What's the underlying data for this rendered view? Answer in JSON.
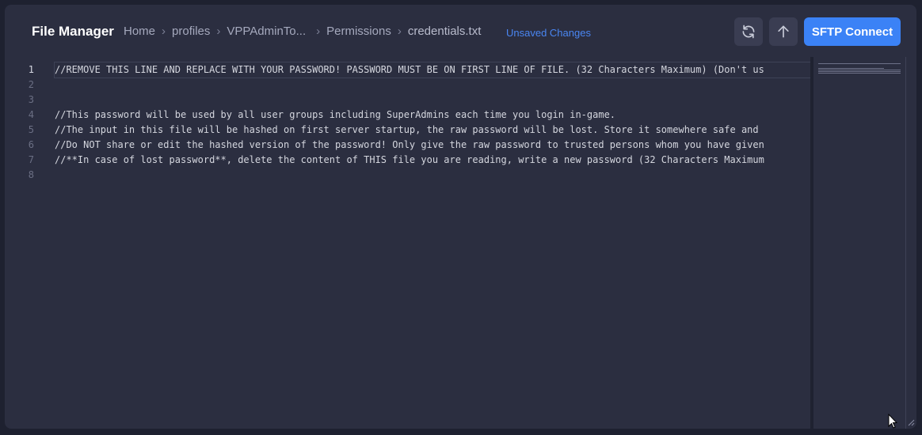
{
  "header": {
    "title": "File Manager",
    "breadcrumb": [
      "Home",
      "profiles",
      "VPPAdminTo...",
      "Permissions",
      "credentials.txt"
    ],
    "unsaved": "Unsaved Changes",
    "refresh_icon": "refresh-icon",
    "upload_icon": "arrow-up-icon",
    "sftp_label": "SFTP Connect"
  },
  "editor": {
    "lines": [
      {
        "num": "1",
        "text": "//REMOVE THIS LINE AND REPLACE WITH YOUR PASSWORD! PASSWORD MUST BE ON FIRST LINE OF FILE. (32 Characters Maximum) (Don't us"
      },
      {
        "num": "2",
        "text": ""
      },
      {
        "num": "3",
        "text": ""
      },
      {
        "num": "4",
        "text": "//This password will be used by all user groups including SuperAdmins each time you login in-game."
      },
      {
        "num": "5",
        "text": "//The input in this file will be hashed on first server startup, the raw password will be lost. Store it somewhere safe and"
      },
      {
        "num": "6",
        "text": "//Do NOT share or edit the hashed version of the password! Only give the raw password to trusted persons whom you have given"
      },
      {
        "num": "7",
        "text": "//**In case of lost password**, delete the content of THIS file you are reading, write a new password (32 Characters Maximum"
      },
      {
        "num": "8",
        "text": ""
      }
    ]
  },
  "colors": {
    "background": "#1e2130",
    "panel": "#2b2e40",
    "accent": "#3b82f6",
    "unsaved": "#4a86f2"
  }
}
